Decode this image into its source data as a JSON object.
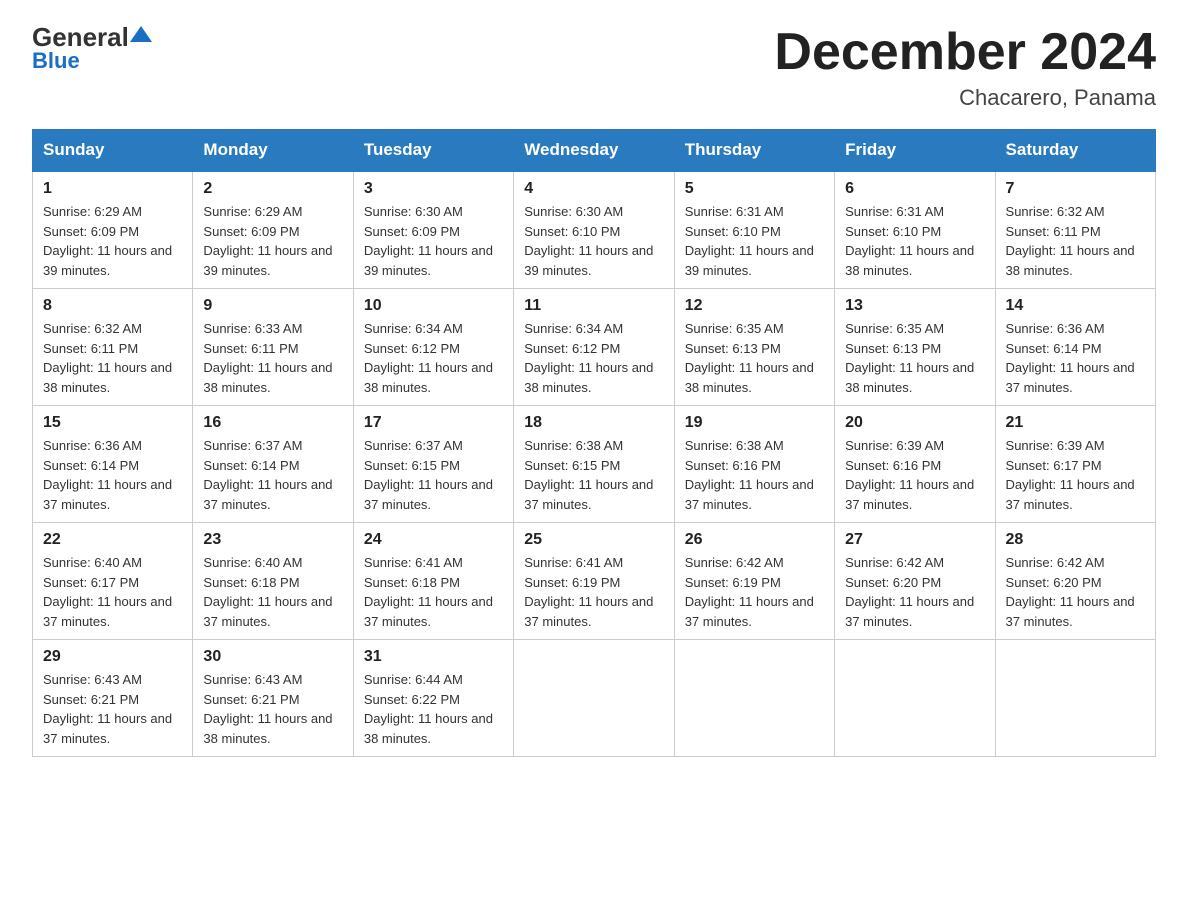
{
  "header": {
    "logo_general": "General",
    "logo_blue": "Blue",
    "title": "December 2024",
    "location": "Chacarero, Panama"
  },
  "weekdays": [
    "Sunday",
    "Monday",
    "Tuesday",
    "Wednesday",
    "Thursday",
    "Friday",
    "Saturday"
  ],
  "weeks": [
    [
      {
        "day": "1",
        "sunrise": "6:29 AM",
        "sunset": "6:09 PM",
        "daylight": "11 hours and 39 minutes."
      },
      {
        "day": "2",
        "sunrise": "6:29 AM",
        "sunset": "6:09 PM",
        "daylight": "11 hours and 39 minutes."
      },
      {
        "day": "3",
        "sunrise": "6:30 AM",
        "sunset": "6:09 PM",
        "daylight": "11 hours and 39 minutes."
      },
      {
        "day": "4",
        "sunrise": "6:30 AM",
        "sunset": "6:10 PM",
        "daylight": "11 hours and 39 minutes."
      },
      {
        "day": "5",
        "sunrise": "6:31 AM",
        "sunset": "6:10 PM",
        "daylight": "11 hours and 39 minutes."
      },
      {
        "day": "6",
        "sunrise": "6:31 AM",
        "sunset": "6:10 PM",
        "daylight": "11 hours and 38 minutes."
      },
      {
        "day": "7",
        "sunrise": "6:32 AM",
        "sunset": "6:11 PM",
        "daylight": "11 hours and 38 minutes."
      }
    ],
    [
      {
        "day": "8",
        "sunrise": "6:32 AM",
        "sunset": "6:11 PM",
        "daylight": "11 hours and 38 minutes."
      },
      {
        "day": "9",
        "sunrise": "6:33 AM",
        "sunset": "6:11 PM",
        "daylight": "11 hours and 38 minutes."
      },
      {
        "day": "10",
        "sunrise": "6:34 AM",
        "sunset": "6:12 PM",
        "daylight": "11 hours and 38 minutes."
      },
      {
        "day": "11",
        "sunrise": "6:34 AM",
        "sunset": "6:12 PM",
        "daylight": "11 hours and 38 minutes."
      },
      {
        "day": "12",
        "sunrise": "6:35 AM",
        "sunset": "6:13 PM",
        "daylight": "11 hours and 38 minutes."
      },
      {
        "day": "13",
        "sunrise": "6:35 AM",
        "sunset": "6:13 PM",
        "daylight": "11 hours and 38 minutes."
      },
      {
        "day": "14",
        "sunrise": "6:36 AM",
        "sunset": "6:14 PM",
        "daylight": "11 hours and 37 minutes."
      }
    ],
    [
      {
        "day": "15",
        "sunrise": "6:36 AM",
        "sunset": "6:14 PM",
        "daylight": "11 hours and 37 minutes."
      },
      {
        "day": "16",
        "sunrise": "6:37 AM",
        "sunset": "6:14 PM",
        "daylight": "11 hours and 37 minutes."
      },
      {
        "day": "17",
        "sunrise": "6:37 AM",
        "sunset": "6:15 PM",
        "daylight": "11 hours and 37 minutes."
      },
      {
        "day": "18",
        "sunrise": "6:38 AM",
        "sunset": "6:15 PM",
        "daylight": "11 hours and 37 minutes."
      },
      {
        "day": "19",
        "sunrise": "6:38 AM",
        "sunset": "6:16 PM",
        "daylight": "11 hours and 37 minutes."
      },
      {
        "day": "20",
        "sunrise": "6:39 AM",
        "sunset": "6:16 PM",
        "daylight": "11 hours and 37 minutes."
      },
      {
        "day": "21",
        "sunrise": "6:39 AM",
        "sunset": "6:17 PM",
        "daylight": "11 hours and 37 minutes."
      }
    ],
    [
      {
        "day": "22",
        "sunrise": "6:40 AM",
        "sunset": "6:17 PM",
        "daylight": "11 hours and 37 minutes."
      },
      {
        "day": "23",
        "sunrise": "6:40 AM",
        "sunset": "6:18 PM",
        "daylight": "11 hours and 37 minutes."
      },
      {
        "day": "24",
        "sunrise": "6:41 AM",
        "sunset": "6:18 PM",
        "daylight": "11 hours and 37 minutes."
      },
      {
        "day": "25",
        "sunrise": "6:41 AM",
        "sunset": "6:19 PM",
        "daylight": "11 hours and 37 minutes."
      },
      {
        "day": "26",
        "sunrise": "6:42 AM",
        "sunset": "6:19 PM",
        "daylight": "11 hours and 37 minutes."
      },
      {
        "day": "27",
        "sunrise": "6:42 AM",
        "sunset": "6:20 PM",
        "daylight": "11 hours and 37 minutes."
      },
      {
        "day": "28",
        "sunrise": "6:42 AM",
        "sunset": "6:20 PM",
        "daylight": "11 hours and 37 minutes."
      }
    ],
    [
      {
        "day": "29",
        "sunrise": "6:43 AM",
        "sunset": "6:21 PM",
        "daylight": "11 hours and 37 minutes."
      },
      {
        "day": "30",
        "sunrise": "6:43 AM",
        "sunset": "6:21 PM",
        "daylight": "11 hours and 38 minutes."
      },
      {
        "day": "31",
        "sunrise": "6:44 AM",
        "sunset": "6:22 PM",
        "daylight": "11 hours and 38 minutes."
      },
      null,
      null,
      null,
      null
    ]
  ]
}
